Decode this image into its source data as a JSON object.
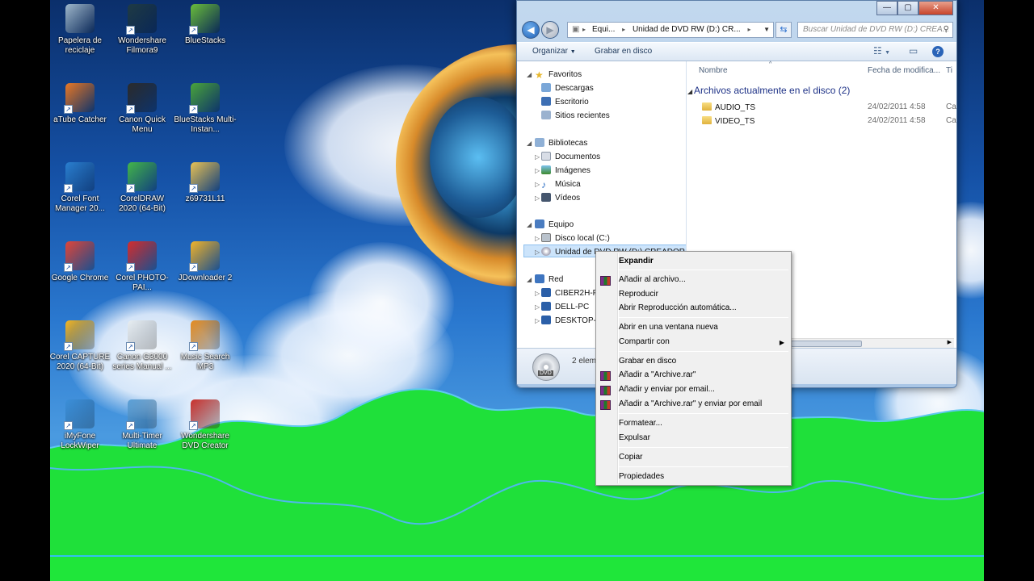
{
  "desktop_icons": [
    {
      "label": "Papelera de reciclaje",
      "icon": "recycle-bin-icon",
      "color": "#9fb8cc"
    },
    {
      "label": "Wondershare Filmora9",
      "icon": "filmora-icon",
      "color": "#1f3b44"
    },
    {
      "label": "BlueStacks",
      "icon": "bluestacks-icon",
      "color": "#6bbf3b"
    },
    {
      "label": "aTube Catcher",
      "icon": "atube-catcher-icon",
      "color": "#e87826"
    },
    {
      "label": "Canon Quick Menu",
      "icon": "canon-quick-menu-icon",
      "color": "#2b2b2b"
    },
    {
      "label": "BlueStacks Multi-Instan...",
      "icon": "bluestacks-multi-icon",
      "color": "#4aa53a"
    },
    {
      "label": "Corel Font Manager 20...",
      "icon": "corel-font-manager-icon",
      "color": "#2a7fd0"
    },
    {
      "label": "CorelDRAW 2020 (64-Bit)",
      "icon": "coreldraw-icon",
      "color": "#43b649"
    },
    {
      "label": "z69731L11",
      "icon": "zip-folder-icon",
      "color": "#e9c354"
    },
    {
      "label": "Google Chrome",
      "icon": "chrome-icon",
      "color": "#e0463a"
    },
    {
      "label": "Corel PHOTO-PAI...",
      "icon": "corel-photo-paint-icon",
      "color": "#d42d2d"
    },
    {
      "label": "JDownloader 2",
      "icon": "jdownloader-icon",
      "color": "#f2b42a"
    },
    {
      "label": "Corel CAPTURE 2020 (64-Bit)",
      "icon": "corel-capture-icon",
      "color": "#f5b521"
    },
    {
      "label": "Canon G3000 series Manual ...",
      "icon": "canon-manual-icon",
      "color": "#e8eef2"
    },
    {
      "label": "Music Search MP3",
      "icon": "music-search-icon",
      "color": "#e48b1f"
    },
    {
      "label": "iMyFone LockWiper",
      "icon": "imyfone-icon",
      "color": "#3b8fd9"
    },
    {
      "label": "Multi-Timer Ultimate",
      "icon": "stopwatch-icon",
      "color": "#5aa0d8"
    },
    {
      "label": "Wondershare DVD Creator",
      "icon": "dvd-creator-icon",
      "color": "#c9302c"
    }
  ],
  "explorer": {
    "window_buttons": {
      "minimize": "—",
      "maximize": "▢",
      "close": "✕"
    },
    "address": {
      "seg1": "Equi...",
      "seg2": "Unidad de DVD RW (D:) CR..."
    },
    "search_placeholder": "Buscar Unidad de DVD RW (D:) CREA...",
    "toolbar": {
      "organize": "Organizar",
      "burn": "Grabar en disco"
    },
    "nav": {
      "favorites": "Favoritos",
      "favorites_items": [
        "Descargas",
        "Escritorio",
        "Sitios recientes"
      ],
      "libraries": "Bibliotecas",
      "libraries_items": [
        "Documentos",
        "Imágenes",
        "Música",
        "Vídeos"
      ],
      "computer": "Equipo",
      "computer_items": [
        "Disco local (C:)",
        "Unidad de DVD RW (D:) CREADOR DE L"
      ],
      "network": "Red",
      "network_items": [
        "CIBER2H-PC",
        "DELL-PC",
        "DESKTOP-16"
      ]
    },
    "columns": {
      "name": "Nombre",
      "date": "Fecha de modifica...",
      "type": "Ti"
    },
    "group_title": "Archivos actualmente en el disco (2)",
    "files": [
      {
        "name": "AUDIO_TS",
        "date": "24/02/2011 4:58",
        "type": "Ca"
      },
      {
        "name": "VIDEO_TS",
        "date": "24/02/2011 4:58",
        "type": "Ca"
      }
    ],
    "status": "2 elem",
    "dvd_label": "DVD"
  },
  "context_menu": {
    "items": [
      {
        "label": "Expandir",
        "bold": true
      },
      {
        "label": "Añadir al archivo...",
        "rar": true
      },
      {
        "label": "Reproducir"
      },
      {
        "label": "Abrir Reproducción automática..."
      },
      {
        "label": "Abrir en una ventana nueva"
      },
      {
        "label": "Compartir con",
        "submenu": true
      },
      {
        "label": "Grabar en disco"
      },
      {
        "label": "Añadir a \"Archive.rar\"",
        "rar": true
      },
      {
        "label": "Añadir y enviar por email...",
        "rar": true
      },
      {
        "label": "Añadir a \"Archive.rar\" y enviar por email",
        "rar": true
      },
      {
        "label": "Formatear..."
      },
      {
        "label": "Expulsar"
      },
      {
        "label": "Copiar"
      },
      {
        "label": "Propiedades"
      }
    ]
  }
}
